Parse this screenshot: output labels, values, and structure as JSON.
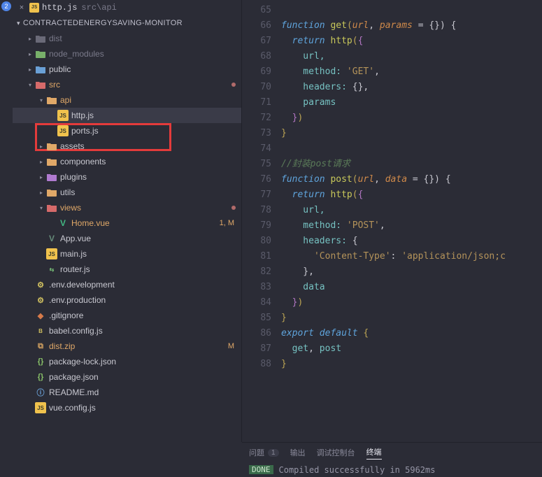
{
  "activity": {
    "explorer_badge": "2"
  },
  "tab": {
    "close": "×",
    "icon_text": "JS",
    "label": "http.js",
    "path": "src\\api"
  },
  "section": {
    "chevron": "▾",
    "title": "CONTRACTEDENERGYSAVING-MONITOR"
  },
  "tree": {
    "dist": "dist",
    "node_modules": "node_modules",
    "public": "public",
    "src": "src",
    "api": "api",
    "http": "http.js",
    "ports": "ports.js",
    "assets": "assets",
    "components": "components",
    "plugins": "plugins",
    "utils": "utils",
    "views": "views",
    "home": "Home.vue",
    "home_status": "1, M",
    "app": "App.vue",
    "main": "main.js",
    "router": "router.js",
    "envdev": ".env.development",
    "envprod": ".env.production",
    "gitignore": ".gitignore",
    "babel": "babel.config.js",
    "distzip": "dist.zip",
    "distzip_status": "M",
    "pkglock": "package-lock.json",
    "pkg": "package.json",
    "readme": "README.md",
    "vuecfg": "vue.config.js"
  },
  "gutter": [
    "65",
    "66",
    "67",
    "68",
    "69",
    "70",
    "71",
    "72",
    "73",
    "74",
    "75",
    "76",
    "77",
    "78",
    "79",
    "80",
    "81",
    "82",
    "83",
    "84",
    "85",
    "86",
    "87",
    "88"
  ],
  "code": {
    "l65a": "function ",
    "l65b": "get",
    "l65c": "(",
    "l65d": "url",
    "l65e": ", ",
    "l65f": "params",
    "l65g": " = {}) {",
    "l66a": "  return ",
    "l66b": "http",
    "l66c": "(",
    "l66d": "{",
    "l67": "    url,",
    "l68a": "    method: ",
    "l68b": "'GET'",
    "l68c": ",",
    "l69a": "    headers: ",
    "l69b": "{}",
    "l69c": ",",
    "l70": "    params",
    "l71a": "  }",
    "l71b": ")",
    "l72": "}",
    "l73": "",
    "l74": "//封装post请求",
    "l75a": "function ",
    "l75b": "post",
    "l75c": "(",
    "l75d": "url",
    "l75e": ", ",
    "l75f": "data",
    "l75g": " = {}) {",
    "l76a": "  return ",
    "l76b": "http",
    "l76c": "(",
    "l76d": "{",
    "l77": "    url,",
    "l78a": "    method: ",
    "l78b": "'POST'",
    "l78c": ",",
    "l79a": "    headers: ",
    "l79b": "{",
    "l80a": "      ",
    "l80b": "'Content-Type'",
    "l80c": ": ",
    "l80d": "'application/json;c",
    "l81": "    },",
    "l82": "    data",
    "l83a": "  }",
    "l83b": ")",
    "l84": "}",
    "l85a": "export ",
    "l85b": "default ",
    "l85c": "{",
    "l86a": "  get",
    "l86b": ", ",
    "l86c": "post",
    "l87": "}",
    "l88": ""
  },
  "panel": {
    "problems": "问题",
    "problems_count": "1",
    "output": "输出",
    "debug": "调试控制台",
    "terminal": "终端",
    "done": "DONE",
    "msg": "Compiled successfully in 5962ms"
  }
}
